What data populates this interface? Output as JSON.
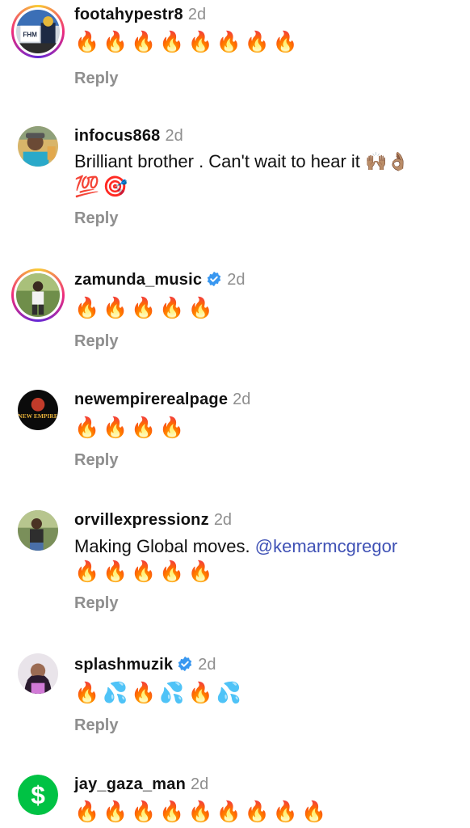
{
  "reply_label": "Reply",
  "colors": {
    "text": "#111111",
    "muted": "#8e8e8e",
    "mention": "#3f51b5",
    "verified": "#3897f0",
    "story_ring": "#ee2a7b"
  },
  "comments": [
    {
      "username": "footahypestr8",
      "time": "2d",
      "verified": false,
      "text": "",
      "emojis": "🔥🔥🔥🔥🔥🔥🔥🔥"
    },
    {
      "username": "infocus868",
      "time": "2d",
      "verified": false,
      "text": "Brilliant brother . Can't wait to hear it 🙌🏽👌🏽",
      "emojis": "💯🎯"
    },
    {
      "username": "zamunda_music",
      "time": "2d",
      "verified": true,
      "text": "",
      "emojis": "🔥🔥🔥🔥🔥"
    },
    {
      "username": "newempirerealpage",
      "time": "2d",
      "verified": false,
      "text": "",
      "emojis": "🔥🔥🔥🔥"
    },
    {
      "username": "orvillexpressionz",
      "time": "2d",
      "verified": false,
      "text": "Making Global moves.",
      "mention": "@kemarmcgregor",
      "emojis": "🔥🔥🔥🔥🔥"
    },
    {
      "username": "splashmuzik",
      "time": "2d",
      "verified": true,
      "text": "",
      "emojis": "🔥💦🔥💦🔥💦"
    },
    {
      "username": "jay_gaza_man",
      "time": "2d",
      "verified": false,
      "text": "",
      "emojis": "🔥🔥🔥🔥🔥🔥🔥🔥🔥"
    }
  ],
  "avatar_labels": {
    "footahypestr8": "FHM",
    "newempirerealpage": "NEW EMPIRE",
    "jay_gaza_man": "$"
  }
}
